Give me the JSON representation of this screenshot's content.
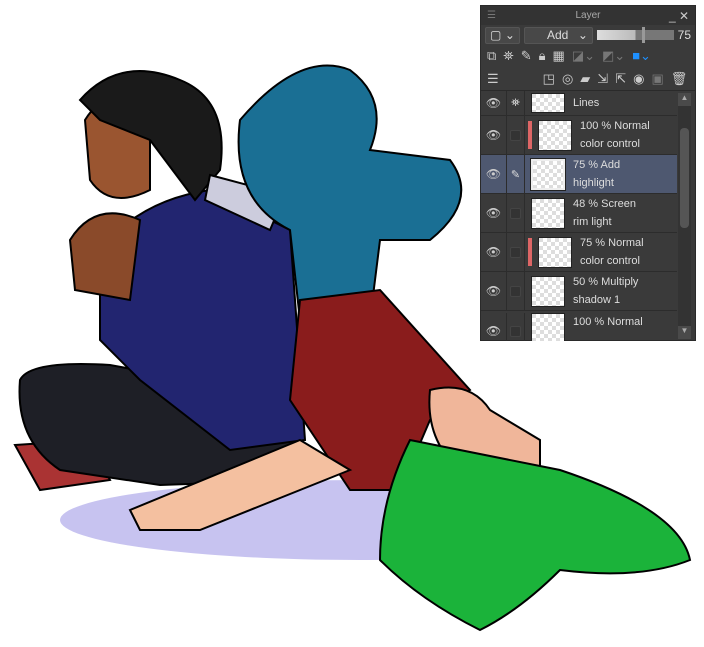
{
  "panel": {
    "title": "Layer",
    "blend_mode": "Add",
    "opacity": "75",
    "layers": [
      {
        "mode": "",
        "name": "Lines",
        "icon": "lock-icon"
      },
      {
        "mode": "100 % Normal",
        "name": "color control",
        "clip": true
      },
      {
        "mode": "75 % Add",
        "name": "highlight",
        "selected": true
      },
      {
        "mode": "48 % Screen",
        "name": "rim light"
      },
      {
        "mode": "75 % Normal",
        "name": "color control",
        "clip": true
      },
      {
        "mode": "50 % Multiply",
        "name": "shadow 1"
      },
      {
        "mode": "100 % Normal",
        "name": ""
      }
    ]
  },
  "colors": {
    "panel_bg": "#3a3a3a",
    "selected": "#4e5870",
    "clip": "#dd6666"
  }
}
